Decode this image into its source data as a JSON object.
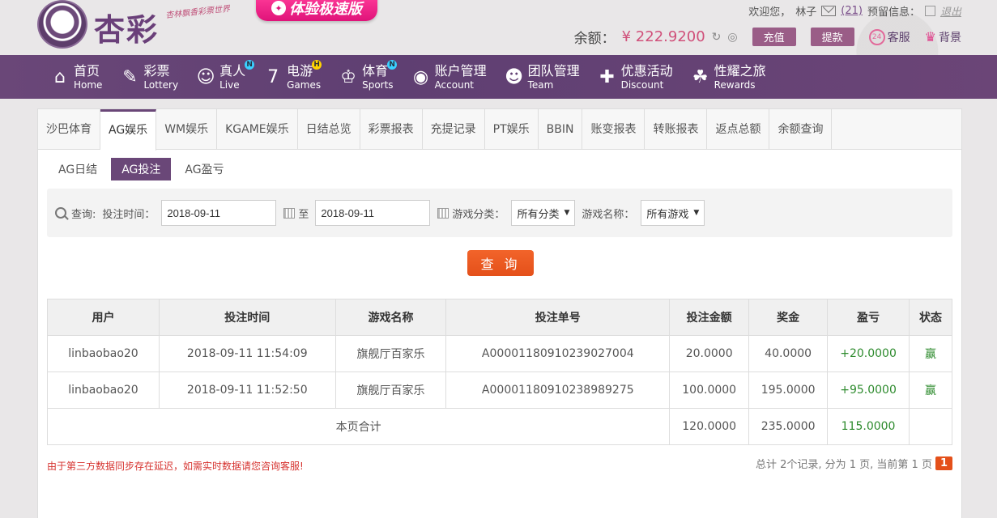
{
  "header": {
    "logo_text": "杏彩",
    "slogan": "杏林飘香彩票世界",
    "promo": "体验极速版",
    "greeting": "欢迎您，",
    "username": "林子",
    "messages": "(21)",
    "reserve_info": "预留信息：",
    "logout": "退出",
    "balance_label": "余额：",
    "balance_value": "¥ 222.9200",
    "deposit": "充值",
    "withdraw": "提款",
    "service": "客服",
    "background": "背景"
  },
  "nav": [
    {
      "cn": "首页",
      "en": "Home",
      "icon": "⌂",
      "badge": ""
    },
    {
      "cn": "彩票",
      "en": "Lottery",
      "icon": "✎",
      "badge": ""
    },
    {
      "cn": "真人",
      "en": "Live",
      "icon": "☺",
      "badge": "N"
    },
    {
      "cn": "电游",
      "en": "Games",
      "icon": "7",
      "badge": "H"
    },
    {
      "cn": "体育",
      "en": "Sports",
      "icon": "♔",
      "badge": "N"
    },
    {
      "cn": "账户管理",
      "en": "Account",
      "icon": "◉",
      "badge": ""
    },
    {
      "cn": "团队管理",
      "en": "Team",
      "icon": "☻",
      "badge": ""
    },
    {
      "cn": "优惠活动",
      "en": "Discount",
      "icon": "✚",
      "badge": ""
    },
    {
      "cn": "性耀之旅",
      "en": "Rewards",
      "icon": "☘",
      "badge": ""
    }
  ],
  "tabs": [
    "沙巴体育",
    "AG娱乐",
    "WM娱乐",
    "KGAME娱乐",
    "日结总览",
    "彩票报表",
    "充提记录",
    "PT娱乐",
    "BBIN",
    "账变报表",
    "转账报表",
    "返点总额",
    "余额查询"
  ],
  "active_tab": "AG娱乐",
  "subtabs": [
    "AG日结",
    "AG投注",
    "AG盈亏"
  ],
  "active_subtab": "AG投注",
  "filter": {
    "query_label": "查询:",
    "time_label": "投注时间：",
    "start_date": "2018-09-11",
    "to": "至",
    "end_date": "2018-09-11",
    "category_label": "游戏分类：",
    "category_value": "所有分类",
    "game_label": "游戏名称：",
    "game_value": "所有游戏",
    "query_button": "查 询"
  },
  "table": {
    "headers": [
      "用户",
      "投注时间",
      "游戏名称",
      "投注单号",
      "投注金额",
      "奖金",
      "盈亏",
      "状态"
    ],
    "rows": [
      [
        "linbaobao20",
        "2018-09-11 11:54:09",
        "旗舰厅百家乐",
        "A0000118091023902700​4",
        "20.0000",
        "40.0000",
        "+20.0000",
        "赢"
      ],
      [
        "linbaobao20",
        "2018-09-11 11:52:50",
        "旗舰厅百家乐",
        "A0000118091023898927​5",
        "100.0000",
        "195.0000",
        "+95.0000",
        "赢"
      ]
    ],
    "total_label": "本页合计",
    "total_bet": "120.0000",
    "total_bonus": "235.0000",
    "total_profit": "115.0000"
  },
  "notice": "由于第三方数据同步存在延迟，如需实时数据请您咨询客服!",
  "pager": {
    "text": "总计 2个记录, 分为 1 页, 当前第 1 页",
    "current": "1"
  }
}
